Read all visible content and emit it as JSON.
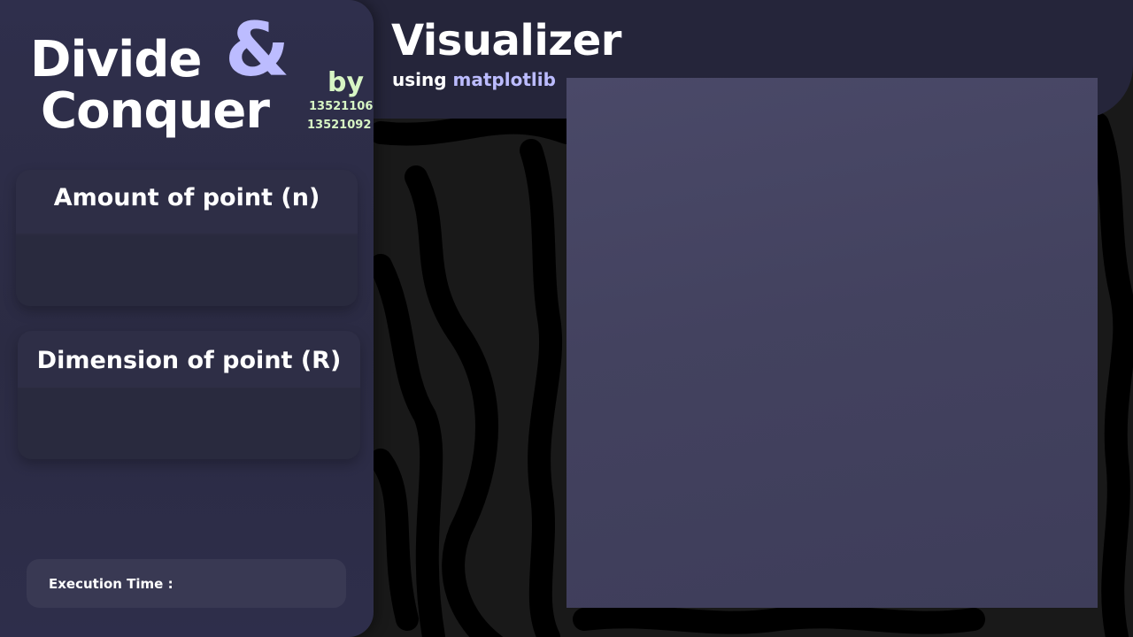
{
  "app": {
    "logo": {
      "word1": "Divide",
      "ampersand": "&",
      "word2": "Conquer",
      "by": "by",
      "ids": [
        "13521106",
        "13521092"
      ]
    },
    "visualizer": {
      "title": "Visualizer",
      "subtitle_prefix": "using",
      "subtitle_lib": "matplotlib"
    },
    "inputs": {
      "amount": {
        "label": "Amount of point (n)",
        "value": ""
      },
      "dimension": {
        "label": "Dimension of point (R)",
        "value": ""
      }
    },
    "execution": {
      "label": "Execution Time :",
      "value": ""
    }
  },
  "colors": {
    "accent_lavender": "#bcbcff",
    "accent_green": "#d7f5c4",
    "sidebar": "#2e2e4a",
    "header": "#25253a",
    "plot": "#44435f"
  }
}
